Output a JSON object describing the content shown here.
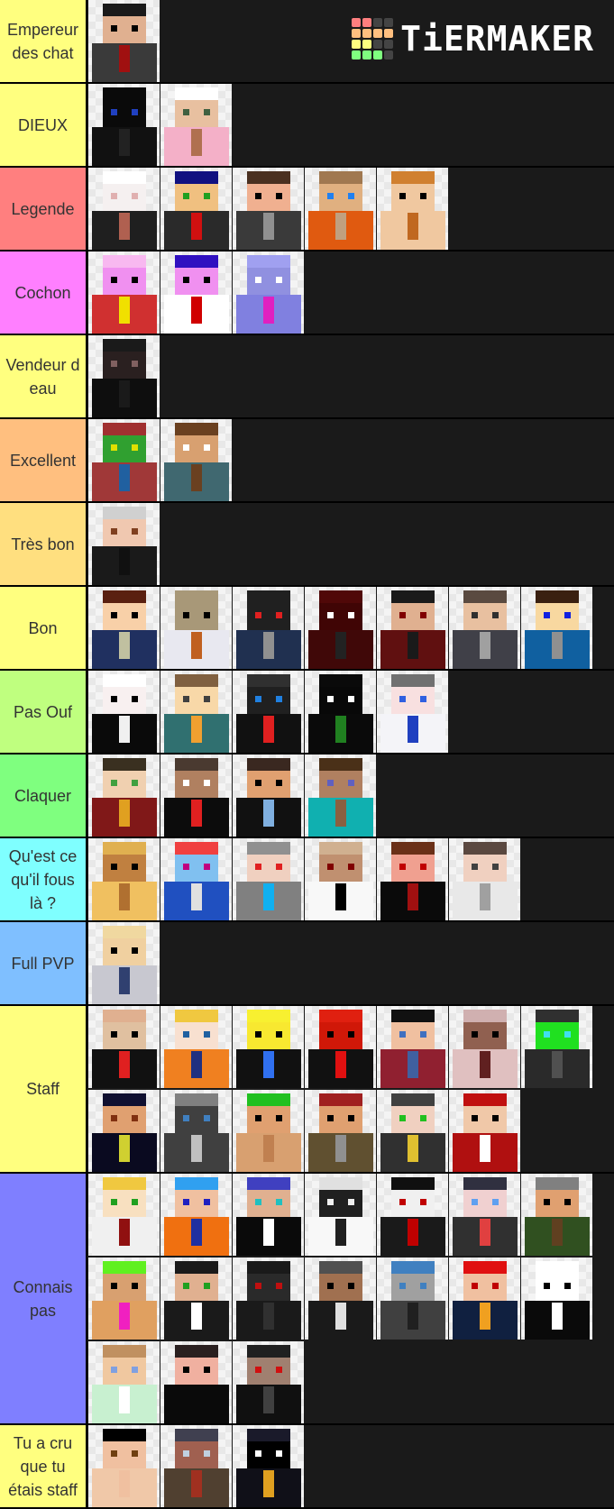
{
  "logo": {
    "text": "TiERMAKER",
    "grid": [
      [
        "#ff7f7f",
        "#ff7f7f",
        "#444444",
        "#444444"
      ],
      [
        "#ffbf7f",
        "#ffbf7f",
        "#ffbf7f",
        "#ffbf7f"
      ],
      [
        "#ffff7f",
        "#ffff7f",
        "#444444",
        "#444444"
      ],
      [
        "#7fff7f",
        "#7fff7f",
        "#7fff7f",
        "#444444"
      ]
    ]
  },
  "tiers": [
    {
      "label": "Empereur des chat",
      "color": "#ffff7f",
      "rows": 1,
      "items": [
        {
          "name": "suit-sunglasses",
          "hair": "#1a1a1a",
          "face": "#e0b090",
          "eyes": "#000000",
          "body": "#3a3a3a",
          "accent": "#a01010"
        }
      ]
    },
    {
      "label": "DIEUX",
      "color": "#ffff7f",
      "rows": 1,
      "items": [
        {
          "name": "black-hooded",
          "hair": "#0a0a0a",
          "face": "#0a0a0a",
          "eyes": "#2040c0",
          "body": "#111111",
          "accent": "#222222"
        },
        {
          "name": "unicorn-girl",
          "hair": "#ffffff",
          "face": "#e8c0a0",
          "eyes": "#406040",
          "body": "#f4b0c8",
          "accent": "#b07050"
        }
      ]
    },
    {
      "label": "Legende",
      "color": "#ff7f7f",
      "rows": 1,
      "items": [
        {
          "name": "white-cat-suit",
          "hair": "#ffffff",
          "face": "#f5f0f0",
          "eyes": "#e0b0b0",
          "body": "#1f1f1f",
          "accent": "#b06050"
        },
        {
          "name": "blue-hair-boy",
          "hair": "#101080",
          "face": "#f0c080",
          "eyes": "#20a020",
          "body": "#2a2a2a",
          "accent": "#d01010"
        },
        {
          "name": "brown-hair-gray",
          "hair": "#4a3020",
          "face": "#f0b090",
          "eyes": "#000000",
          "body": "#3a3a3a",
          "accent": "#909090"
        },
        {
          "name": "fox-girl",
          "hair": "#a07850",
          "face": "#e0b080",
          "eyes": "#2080f0",
          "body": "#e05a10",
          "accent": "#c0a080"
        },
        {
          "name": "beard-man",
          "hair": "#d08030",
          "face": "#f0c8a0",
          "eyes": "#000000",
          "body": "#f0c8a0",
          "accent": "#c06820"
        }
      ]
    },
    {
      "label": "Cochon",
      "color": "#ff7fff",
      "rows": 1,
      "items": [
        {
          "name": "pig-soviet",
          "hair": "#f8b8f0",
          "face": "#f090f0",
          "eyes": "#000000",
          "body": "#d03030",
          "accent": "#f0e000"
        },
        {
          "name": "pig-france",
          "hair": "#3010c0",
          "face": "#f090f0",
          "eyes": "#000000",
          "body": "#ffffff",
          "accent": "#d00000"
        },
        {
          "name": "pig-purple",
          "hair": "#a0a0f0",
          "face": "#9090e0",
          "eyes": "#ffffff",
          "body": "#8080e0",
          "accent": "#e020c0"
        }
      ]
    },
    {
      "label": "Vendeur d eau",
      "color": "#ffff7f",
      "rows": 1,
      "items": [
        {
          "name": "dark-hood",
          "hair": "#1a1a1a",
          "face": "#2a2020",
          "eyes": "#806060",
          "body": "#0e0e0e",
          "accent": "#1a1a1a"
        }
      ]
    },
    {
      "label": "Excellent",
      "color": "#ffbf7f",
      "rows": 1,
      "items": [
        {
          "name": "rainbow-mask",
          "hair": "#a03030",
          "face": "#30a030",
          "eyes": "#e0e000",
          "body": "#a03838",
          "accent": "#2060a0"
        },
        {
          "name": "mustache-man",
          "hair": "#6a4020",
          "face": "#d8a070",
          "eyes": "#ffffff",
          "body": "#406870",
          "accent": "#6a4020"
        }
      ]
    },
    {
      "label": "Très bon",
      "color": "#ffdf7f",
      "rows": 1,
      "items": [
        {
          "name": "silver-hair",
          "hair": "#d0d0d0",
          "face": "#f0c8b0",
          "eyes": "#804020",
          "body": "#1a1a1a",
          "accent": "#101010"
        }
      ]
    },
    {
      "label": "Bon",
      "color": "#ffff7f",
      "rows": 1,
      "items": [
        {
          "name": "winter-sweater",
          "hair": "#5a2010",
          "face": "#f8d0a8",
          "eyes": "#000000",
          "body": "#203060",
          "accent": "#c0c0a0"
        },
        {
          "name": "bald-white",
          "hair": "#a89878",
          "face": "#a89878",
          "eyes": "#000000",
          "body": "#e8e8f0",
          "accent": "#c06020"
        },
        {
          "name": "ninja-red-eyes",
          "hair": "#202020",
          "face": "#202020",
          "eyes": "#e02020",
          "body": "#203050",
          "accent": "#909090"
        },
        {
          "name": "red-demon",
          "hair": "#500808",
          "face": "#400505",
          "eyes": "#ffffff",
          "body": "#400808",
          "accent": "#222222"
        },
        {
          "name": "dark-red-hood",
          "hair": "#1a1a1a",
          "face": "#e0b090",
          "eyes": "#800000",
          "body": "#601010",
          "accent": "#1a1a1a"
        },
        {
          "name": "gray-hoodie",
          "hair": "#5a4a40",
          "face": "#e8c0a0",
          "eyes": "#303030",
          "body": "#404048",
          "accent": "#a0a0a0"
        },
        {
          "name": "blue-flannel",
          "hair": "#3a2010",
          "face": "#f8d8a0",
          "eyes": "#1020e0",
          "body": "#1060a0",
          "accent": "#909090"
        }
      ]
    },
    {
      "label": "Pas Ouf",
      "color": "#bfff7f",
      "rows": 1,
      "items": [
        {
          "name": "panda",
          "hair": "#ffffff",
          "face": "#f8f0f0",
          "eyes": "#000000",
          "body": "#0a0a0a",
          "accent": "#f0f0f0"
        },
        {
          "name": "teal-cape",
          "hair": "#806040",
          "face": "#f8d8a8",
          "eyes": "#404040",
          "body": "#307070",
          "accent": "#f0a030"
        },
        {
          "name": "black-flag",
          "hair": "#303030",
          "face": "#202020",
          "eyes": "#2080e0",
          "body": "#111111",
          "accent": "#e02020"
        },
        {
          "name": "enderman",
          "hair": "#0a0a0a",
          "face": "#080808",
          "eyes": "#ffffff",
          "body": "#0a0a0a",
          "accent": "#208020"
        },
        {
          "name": "white-dress",
          "hair": "#707070",
          "face": "#f8e0e0",
          "eyes": "#3060e0",
          "body": "#f4f4f8",
          "accent": "#2040c0"
        }
      ]
    },
    {
      "label": "Claquer",
      "color": "#7fff7f",
      "rows": 1,
      "items": [
        {
          "name": "monocle-red",
          "hair": "#3a3020",
          "face": "#f0d0b0",
          "eyes": "#40a040",
          "body": "#801818",
          "accent": "#e0a020"
        },
        {
          "name": "black-sweater",
          "hair": "#4a3a30",
          "face": "#b08060",
          "eyes": "#ffffff",
          "body": "#0c0c0c",
          "accent": "#e02020"
        },
        {
          "name": "crying-boy",
          "hair": "#3a2820",
          "face": "#e0a070",
          "eyes": "#000000",
          "body": "#111111",
          "accent": "#80b0e0"
        },
        {
          "name": "steve",
          "hair": "#4a3018",
          "face": "#b08060",
          "eyes": "#6060c0",
          "body": "#10b0b0",
          "accent": "#8a6040"
        }
      ]
    },
    {
      "label": "Qu'est ce qu'il fous là ?",
      "color": "#7fffff",
      "rows": 1,
      "items": [
        {
          "name": "giraffe",
          "hair": "#e0b050",
          "face": "#c08040",
          "eyes": "#000000",
          "body": "#f0c060",
          "accent": "#b07030"
        },
        {
          "name": "rainbow-pony",
          "hair": "#f04040",
          "face": "#80c0f0",
          "eyes": "#c00080",
          "body": "#2050c0",
          "accent": "#e0e0e0"
        },
        {
          "name": "cyan-hair-girl",
          "hair": "#909090",
          "face": "#f0d0c0",
          "eyes": "#e02020",
          "body": "#808080",
          "accent": "#10b0f0"
        },
        {
          "name": "half-blonde",
          "hair": "#d0b090",
          "face": "#c09070",
          "eyes": "#800000",
          "body": "#f8f8f8",
          "accent": "#000000"
        },
        {
          "name": "red-eyes-hoodie",
          "hair": "#6a3018",
          "face": "#f0a090",
          "eyes": "#c00000",
          "body": "#0a0a0a",
          "accent": "#a01010"
        },
        {
          "name": "white-shirt",
          "hair": "#5a4840",
          "face": "#f0d0c0",
          "eyes": "#404040",
          "body": "#e8e8e8",
          "accent": "#a0a0a0"
        }
      ]
    },
    {
      "label": "Full PVP",
      "color": "#7fbfff",
      "rows": 1,
      "items": [
        {
          "name": "blonde-beard",
          "hair": "#f0d8a0",
          "face": "#f0d0a0",
          "eyes": "#000000",
          "body": "#c8c8d0",
          "accent": "#304070"
        }
      ]
    },
    {
      "label": "Staff",
      "color": "#ffff7f",
      "rows": 2,
      "items": [
        {
          "name": "officer-medic",
          "hair": "#e0b090",
          "face": "#e0c0a0",
          "eyes": "#000000",
          "body": "#111111",
          "accent": "#e02020"
        },
        {
          "name": "naruto-flame",
          "hair": "#f0c840",
          "face": "#f8e0d0",
          "eyes": "#2060a0",
          "body": "#f08020",
          "accent": "#203080"
        },
        {
          "name": "banana",
          "hair": "#f8f030",
          "face": "#f8e830",
          "eyes": "#000000",
          "body": "#111111",
          "accent": "#3070f0"
        },
        {
          "name": "tomato",
          "hair": "#e02010",
          "face": "#d01808",
          "eyes": "#000000",
          "body": "#111111",
          "accent": "#e01010"
        },
        {
          "name": "red-jacket",
          "hair": "#111111",
          "face": "#f0c0a0",
          "eyes": "#4070c0",
          "body": "#902030",
          "accent": "#4060a0"
        },
        {
          "name": "cap-girl",
          "hair": "#d0b0b0",
          "face": "#906050",
          "eyes": "#000000",
          "body": "#e0c0c0",
          "accent": "#602020"
        },
        {
          "name": "green-visor",
          "hair": "#303030",
          "face": "#20e020",
          "eyes": "#40e0f0",
          "body": "#2a2a2a",
          "accent": "#505050"
        },
        {
          "name": "police",
          "hair": "#101030",
          "face": "#e0a070",
          "eyes": "#803010",
          "body": "#0a0a20",
          "accent": "#d0d030"
        },
        {
          "name": "plague-doctor",
          "hair": "#808080",
          "face": "#404040",
          "eyes": "#4080c0",
          "body": "#404040",
          "accent": "#c0c0c0"
        },
        {
          "name": "green-black-hair",
          "hair": "#20c020",
          "face": "#e0a070",
          "eyes": "#000000",
          "body": "#d8a070",
          "accent": "#c08050"
        },
        {
          "name": "beret-camo",
          "hair": "#a02020",
          "face": "#e0a070",
          "eyes": "#000000",
          "body": "#605030",
          "accent": "#909090"
        },
        {
          "name": "military-green",
          "hair": "#404040",
          "face": "#f0d0c0",
          "eyes": "#20c020",
          "body": "#303030",
          "accent": "#e0c030"
        },
        {
          "name": "santa-coat",
          "hair": "#c01010",
          "face": "#f0c8a8",
          "eyes": "#000000",
          "body": "#b01010",
          "accent": "#ffffff"
        }
      ]
    },
    {
      "label": "Connais pas",
      "color": "#7f7fff",
      "rows": 3,
      "items": [
        {
          "name": "blonde-bloody",
          "hair": "#f0c840",
          "face": "#f8e0c0",
          "eyes": "#20a020",
          "body": "#f0f0f0",
          "accent": "#901010"
        },
        {
          "name": "goku",
          "hair": "#30a0f0",
          "face": "#f0c0a0",
          "eyes": "#2020c0",
          "body": "#f07010",
          "accent": "#2030a0"
        },
        {
          "name": "headband-black",
          "hair": "#4040c0",
          "face": "#e0b090",
          "eyes": "#20c0c0",
          "body": "#0a0a0a",
          "accent": "#ffffff"
        },
        {
          "name": "white-mask",
          "hair": "#e0e0e0",
          "face": "#202020",
          "eyes": "#f0f0f0",
          "body": "#f8f8f8",
          "accent": "#202020"
        },
        {
          "name": "half-red-black",
          "hair": "#101010",
          "face": "#f0f0f0",
          "eyes": "#c00000",
          "body": "#1a1a1a",
          "accent": "#c00000"
        },
        {
          "name": "anime-red-black",
          "hair": "#303040",
          "face": "#f0d0d0",
          "eyes": "#60a0f0",
          "body": "#303030",
          "accent": "#e04040"
        },
        {
          "name": "camo-green",
          "hair": "#808080",
          "face": "#e0a070",
          "eyes": "#000000",
          "body": "#305020",
          "accent": "#604020"
        },
        {
          "name": "neon-split-hair",
          "hair": "#60f020",
          "face": "#d8a070",
          "eyes": "#000000",
          "body": "#e0a060",
          "accent": "#f020c0"
        },
        {
          "name": "black-hoodie-boy",
          "hair": "#1a1a1a",
          "face": "#e0b090",
          "eyes": "#20a020",
          "body": "#1a1a1a",
          "accent": "#ffffff"
        },
        {
          "name": "dark-visor",
          "hair": "#1a1a1a",
          "face": "#2a2a2a",
          "eyes": "#c01010",
          "body": "#1a1a1a",
          "accent": "#303030"
        },
        {
          "name": "cap-black",
          "hair": "#505050",
          "face": "#a07050",
          "eyes": "#000000",
          "body": "#1a1a1a",
          "accent": "#e0e0e0"
        },
        {
          "name": "blue-helmet",
          "hair": "#4080c0",
          "face": "#a0a0a0",
          "eyes": "#4080c0",
          "body": "#404040",
          "accent": "#202020"
        },
        {
          "name": "fire-hoodie",
          "hair": "#e01010",
          "face": "#f0c0a0",
          "eyes": "#c00000",
          "body": "#102040",
          "accent": "#f0a020"
        },
        {
          "name": "white-apple",
          "hair": "#ffffff",
          "face": "#ffffff",
          "eyes": "#000000",
          "body": "#0a0a0a",
          "accent": "#ffffff"
        },
        {
          "name": "flower-crown",
          "hair": "#c09060",
          "face": "#f0c8a0",
          "eyes": "#80a0e0",
          "body": "#c8f0d0",
          "accent": "#ffffff"
        },
        {
          "name": "black-tee",
          "hair": "#2a2020",
          "face": "#f0b0a0",
          "eyes": "#000000",
          "body": "#0a0a0a",
          "accent": "#0a0a0a"
        },
        {
          "name": "half-mask",
          "hair": "#202020",
          "face": "#a08070",
          "eyes": "#d01010",
          "body": "#101010",
          "accent": "#404040"
        }
      ]
    },
    {
      "label": "Tu a cru que tu étais staff",
      "color": "#ffff7f",
      "rows": 1,
      "items": [
        {
          "name": "shirtless",
          "hair": "#000000",
          "face": "#f0c0a0",
          "eyes": "#704010",
          "body": "#f0c8a8",
          "accent": "#f0c0a0"
        },
        {
          "name": "samurai",
          "hair": "#404050",
          "face": "#a06050",
          "eyes": "#c0d0e0",
          "body": "#504030",
          "accent": "#a03020"
        },
        {
          "name": "gold-hood",
          "hair": "#1a1a2a",
          "face": "#000000",
          "eyes": "#ffffff",
          "body": "#101018",
          "accent": "#e0a020"
        }
      ]
    }
  ]
}
